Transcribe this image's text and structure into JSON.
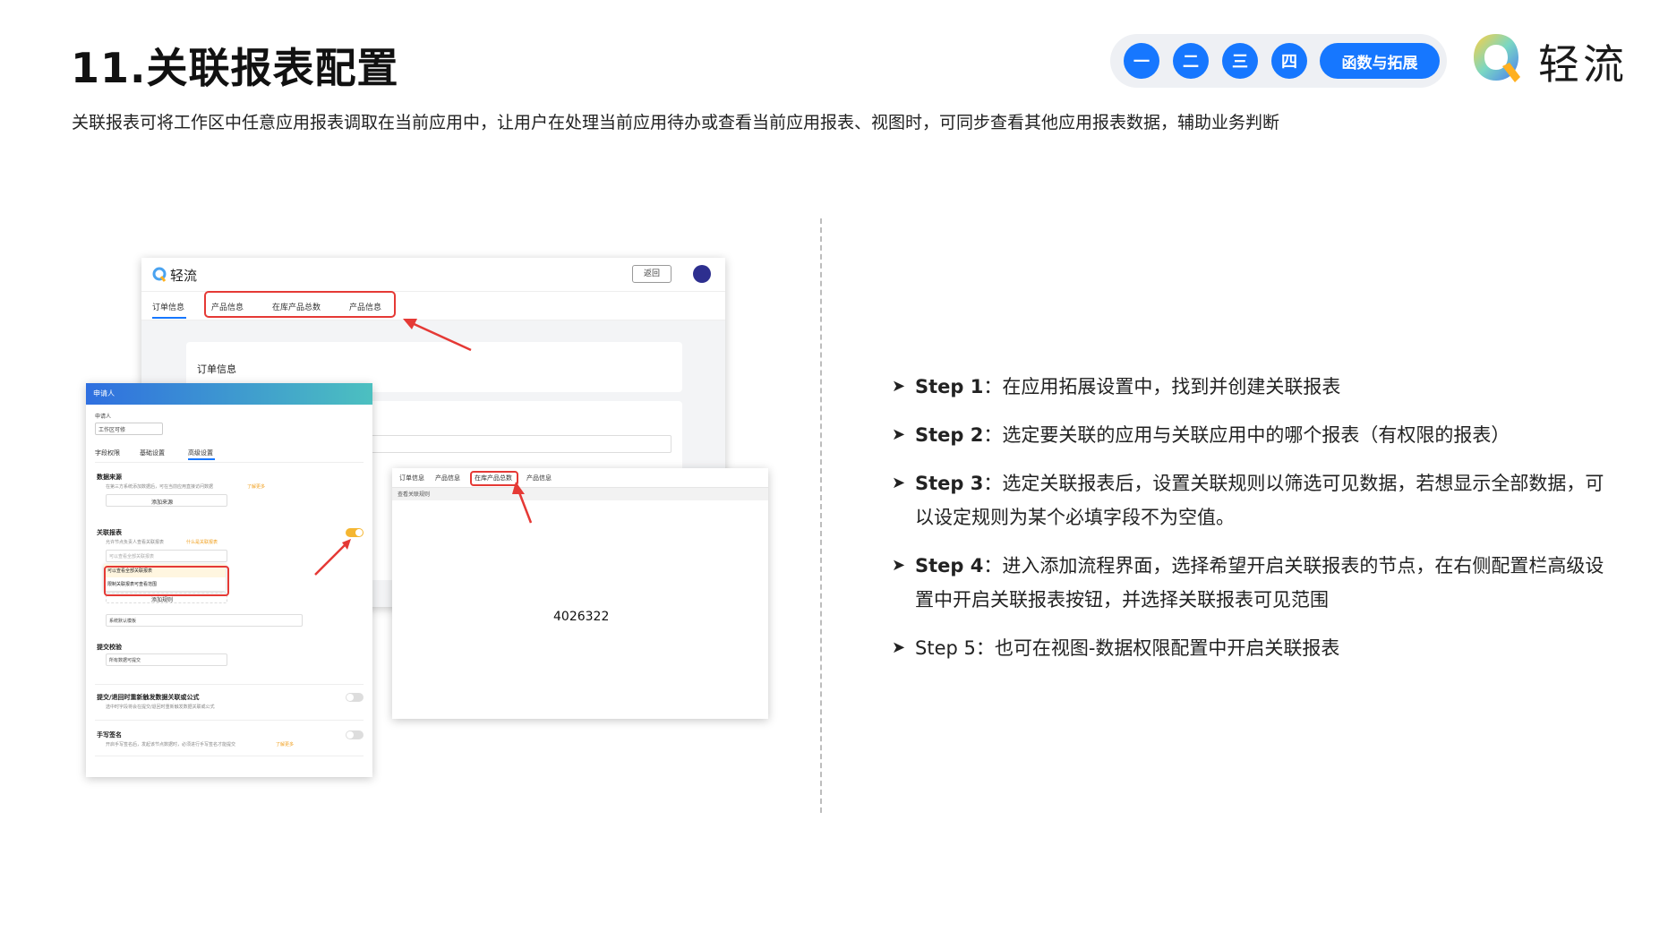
{
  "title": "11.关联报表配置",
  "subtitle": "关联报表可将工作区中任意应用报表调取在当前应用中，让用户在处理当前应用待办或查看当前应用报表、视图时，可同步查看其他应用报表数据，辅助业务判断",
  "nav": {
    "items": [
      "一",
      "二",
      "三",
      "四"
    ],
    "active_tag": "函数与拓展"
  },
  "brand": {
    "name": "轻流"
  },
  "colors": {
    "accent": "#1677ff",
    "highlight": "#e53935",
    "teal_header": "#3fb6c8"
  },
  "mock_main": {
    "brand": "轻流",
    "back_button": "返回",
    "tabs": [
      "订单信息",
      "产品信息",
      "在库产品总数",
      "产品信息"
    ],
    "card_title": "订单信息"
  },
  "mock_panel": {
    "header": "申请人",
    "field_label": "申请人",
    "select_value": "工作区可修",
    "tabs": [
      "字段权限",
      "基础设置",
      "高级设置"
    ],
    "data_source_title": "数据来源",
    "data_source_desc": "在第三方系统添加数据后，可在当前应用直接访问数据",
    "data_source_link": "了解更多",
    "add_source": "添加来源",
    "linked_report_title": "关联报表",
    "linked_report_desc": "允许节点负责人查看关联报表",
    "linked_report_link": "什么是关联报表",
    "linked_select_placeholder": "可以查看全部关联报表",
    "dropdown_options": [
      "可以查看全部关联报表",
      "限制关联报表可查看范围"
    ],
    "add_rule": "添加规则",
    "default_value": "系统默认模板",
    "submit_check_title": "提交校验",
    "submit_check_value": "所有数据可提交",
    "trigger_title": "提交/退回时重新触发数据关联或公式",
    "trigger_desc": "选中时字段将会在提交/退回时重新触发数据关联或公式",
    "signature_title": "手写签名",
    "signature_desc": "开启手写签名后，发起该节点数据时，必须进行手写签名才能提交",
    "signature_link": "了解更多"
  },
  "mock_report": {
    "tabs": [
      "订单信息",
      "产品信息",
      "在库产品总数",
      "产品信息"
    ],
    "toolbar": "查看关联规则",
    "value": "4026322"
  },
  "steps": [
    {
      "label": "Step 1",
      "text": "：在应用拓展设置中，找到并创建关联报表"
    },
    {
      "label": "Step 2",
      "text": "：选定要关联的应用与关联应用中的哪个报表（有权限的报表）"
    },
    {
      "label": "Step 3",
      "text": "：选定关联报表后，设置关联规则以筛选可见数据，若想显示全部数据，可以设定规则为某个必填字段不为空值。"
    },
    {
      "label": "Step 4",
      "text": "：进入添加流程界面，选择希望开启关联报表的节点，在右侧配置栏高级设置中开启关联报表按钮，并选择关联报表可见范围"
    },
    {
      "label": "Step 5",
      "text": "：也可在视图-数据权限配置中开启关联报表"
    }
  ]
}
